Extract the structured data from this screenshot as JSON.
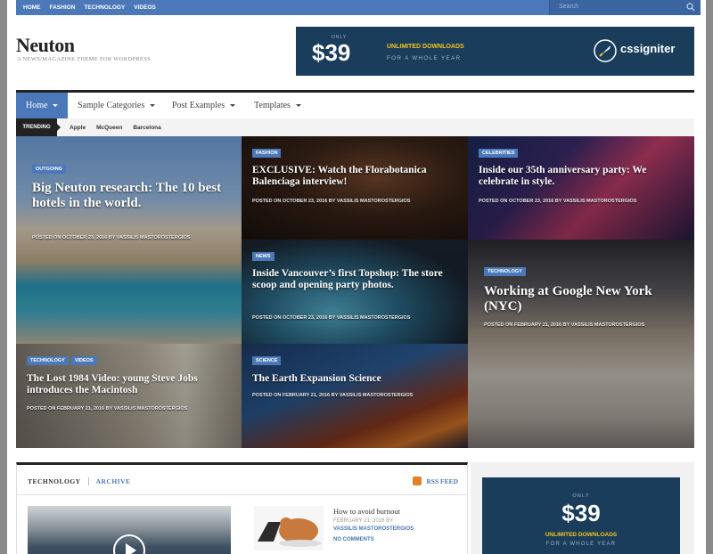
{
  "topnav": {
    "items": [
      "HOME",
      "FASHION",
      "TECHNOLOGY",
      "VIDEOS"
    ],
    "search_placeholder": "Search"
  },
  "header": {
    "logo": "Neuton",
    "tagline": "A NEWS/MAGAZINE THEME FOR WORDPRESS"
  },
  "banner": {
    "only": "ONLY",
    "price": "$39",
    "unlimited": "UNLIMITED DOWNLOADS",
    "whole_year": "FOR A WHOLE YEAR",
    "brand": "cssigniter"
  },
  "mainnav": {
    "items": [
      "Home",
      "Sample Categories",
      "Post Examples",
      "Templates"
    ]
  },
  "trending": {
    "label": "TRENDING",
    "links": [
      "Apple",
      "McQueen",
      "Barcelona"
    ]
  },
  "tiles": [
    {
      "cats": [
        "OUTGOING"
      ],
      "title": "Big Neuton research: The 10 best hotels in the world.",
      "meta": "POSTED ON OCTOBER 23, 2016 BY VASSILIS MASTOROSTERGIOS"
    },
    {
      "cats": [
        "FASHION"
      ],
      "title": "EXCLUSIVE: Watch the Florabotanica Balenciaga interview!",
      "meta": "POSTED ON OCTOBER 23, 2016 BY VASSILIS MASTOROSTERGIOS"
    },
    {
      "cats": [
        "CELEBRITIES"
      ],
      "title": "Inside our 35th anniversary party: We celebrate in style.",
      "meta": "POSTED ON OCTOBER 23, 2016 BY VASSILIS MASTOROSTERGIOS"
    },
    {
      "cats": [
        "NEWS"
      ],
      "title": "Inside Vancouver’s first Topshop: The store scoop and opening party photos.",
      "meta": "POSTED ON OCTOBER 23, 2016 BY VASSILIS MASTOROSTERGIOS"
    },
    {
      "cats": [
        "TECHNOLOGY"
      ],
      "title": "Working at Google New York (NYC)",
      "meta": "POSTED ON FEBRUARY 21, 2016 BY VASSILIS MASTOROSTERGIOS"
    },
    {
      "cats": [
        "TECHNOLOGY",
        "VIDEOS"
      ],
      "title": "The Lost 1984 Video: young Steve Jobs introduces the Macintosh",
      "meta": "POSTED ON FEBRUARY 21, 2016 BY VASSILIS MASTOROSTERGIOS"
    },
    {
      "cats": [
        "SCIENCE"
      ],
      "title": "The Earth Expansion Science",
      "meta": "POSTED ON FEBRUARY 21, 2016 BY VASSILIS MASTOROSTERGIOS"
    }
  ],
  "section": {
    "title": "TECHNOLOGY",
    "archive": "ARCHIVE",
    "rss": "RSS FEED",
    "post": {
      "title": "How to avoid burnout",
      "date": "FEBRUARY 21, 2016 BY",
      "author": "VASSILIS MASTOROSTERGIOS",
      "comments": "NO COMMENTS"
    }
  },
  "sidebar_ad": {
    "only": "ONLY",
    "price": "$39",
    "unlimited": "UNLIMITED DOWNLOADS",
    "whole_year": "FOR A WHOLE YEAR"
  },
  "colors": {
    "accent": "#4a78b8",
    "banner": "#1a3d5c",
    "promo": "#f5c518"
  }
}
